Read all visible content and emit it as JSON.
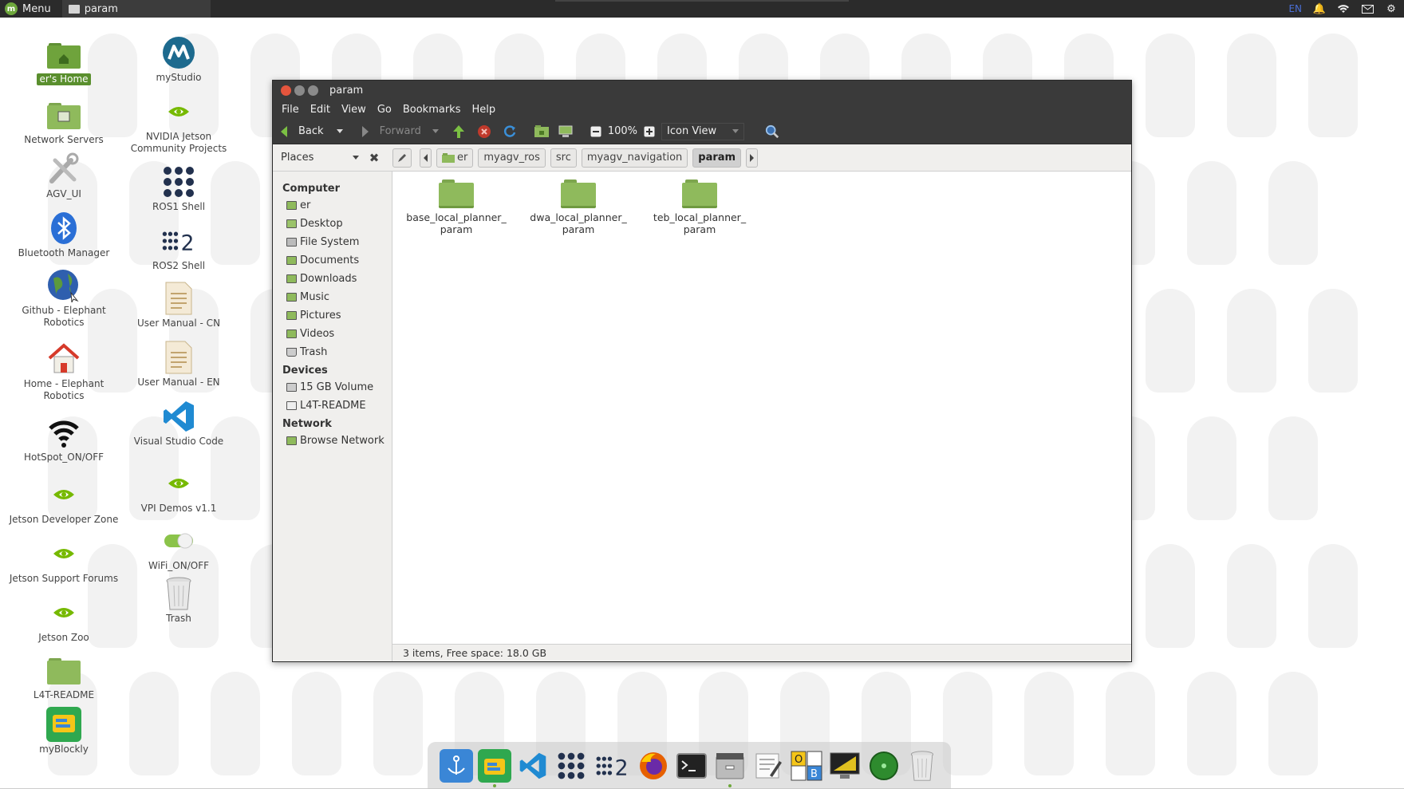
{
  "top_panel": {
    "menu_label": "Menu",
    "task_label": "param",
    "lang": "EN"
  },
  "desktop_icons": [
    {
      "label": "er's Home",
      "icon": "home-folder-icon",
      "selected": true
    },
    {
      "label": "Network Servers",
      "icon": "network-servers-icon"
    },
    {
      "label": "AGV_UI",
      "icon": "tools-icon"
    },
    {
      "label": "Bluetooth Manager",
      "icon": "bluetooth-icon"
    },
    {
      "label": "Github - Elephant Robotics",
      "icon": "globe-icon"
    },
    {
      "label": "Home - Elephant Robotics",
      "icon": "house-icon"
    },
    {
      "label": "HotSpot_ON/OFF",
      "icon": "wifi-icon"
    },
    {
      "label": "Jetson Developer Zone",
      "icon": "nvidia-icon"
    },
    {
      "label": "Jetson Support Forums",
      "icon": "nvidia-icon"
    },
    {
      "label": "Jetson Zoo",
      "icon": "nvidia-icon"
    },
    {
      "label": "L4T-README",
      "icon": "folder-icon"
    },
    {
      "label": "myBlockly",
      "icon": "myblockly-icon"
    },
    {
      "label": "myStudio",
      "icon": "mystudio-icon"
    },
    {
      "label": "NVIDIA Jetson Community Projects",
      "icon": "nvidia-icon"
    },
    {
      "label": "ROS1 Shell",
      "icon": "ros1-icon"
    },
    {
      "label": "ROS2 Shell",
      "icon": "ros2-icon"
    },
    {
      "label": "User Manual - CN",
      "icon": "document-icon"
    },
    {
      "label": "User Manual - EN",
      "icon": "document-icon"
    },
    {
      "label": "Visual Studio Code",
      "icon": "vscode-icon"
    },
    {
      "label": "VPI Demos v1.1",
      "icon": "nvidia-icon"
    },
    {
      "label": "WiFi_ON/OFF",
      "icon": "toggle-icon"
    },
    {
      "label": "Trash",
      "icon": "trash-icon"
    }
  ],
  "window": {
    "title": "param",
    "menu": [
      "File",
      "Edit",
      "View",
      "Go",
      "Bookmarks",
      "Help"
    ],
    "toolbar": {
      "back": "Back",
      "forward": "Forward",
      "zoom": "100%",
      "view_mode": "Icon View"
    },
    "places_label": "Places",
    "path": [
      "er",
      "myagv_ros",
      "src",
      "myagv_navigation",
      "param"
    ],
    "sidebar": {
      "computer_head": "Computer",
      "computer_items": [
        "er",
        "Desktop",
        "File System",
        "Documents",
        "Downloads",
        "Music",
        "Pictures",
        "Videos",
        "Trash"
      ],
      "devices_head": "Devices",
      "devices_items": [
        "15 GB Volume",
        "L4T-README"
      ],
      "network_head": "Network",
      "network_items": [
        "Browse Network"
      ]
    },
    "files": [
      {
        "name_line1": "base_local_planner_",
        "name_line2": "param"
      },
      {
        "name_line1": "dwa_local_planner_",
        "name_line2": "param"
      },
      {
        "name_line1": "teb_local_planner_",
        "name_line2": "param"
      }
    ],
    "status": "3 items, Free space: 18.0 GB"
  },
  "dock": [
    "anchor-icon",
    "files-icon",
    "vscode-icon",
    "ros1-icon",
    "ros2-icon",
    "firefox-icon",
    "terminal-icon",
    "file-manager-icon",
    "text-editor-icon",
    "ob-icon",
    "monitor-icon",
    "green-circle-icon",
    "trash-icon"
  ],
  "colors": {
    "panel_bg": "#2b2b2b",
    "accent_green": "#6ea83c",
    "close_red": "#e4553d"
  }
}
